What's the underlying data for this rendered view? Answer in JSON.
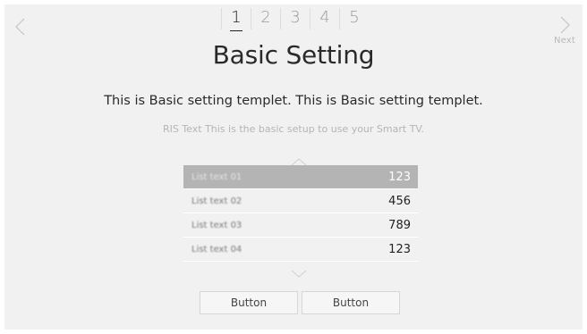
{
  "nav": {
    "prev_icon": "chevron-left-icon",
    "next_icon": "chevron-right-icon",
    "next_label": "Next"
  },
  "steps": [
    {
      "label": "1",
      "active": true
    },
    {
      "label": "2",
      "active": false
    },
    {
      "label": "3",
      "active": false
    },
    {
      "label": "4",
      "active": false
    },
    {
      "label": "5",
      "active": false
    }
  ],
  "title": "Basic Setting",
  "description": "This is Basic setting templet. This is Basic setting templet.",
  "ris_text": "RIS Text This is the basic setup to use your Smart TV.",
  "list": {
    "scroll_up_icon": "chevron-up-icon",
    "scroll_down_icon": "chevron-down-icon",
    "items": [
      {
        "label": "List text 01",
        "value": "123",
        "selected": true
      },
      {
        "label": "List text 02",
        "value": "456",
        "selected": false
      },
      {
        "label": "List text 03",
        "value": "789",
        "selected": false
      },
      {
        "label": "List text 04",
        "value": "123",
        "selected": false
      }
    ]
  },
  "buttons": [
    {
      "label": "Button"
    },
    {
      "label": "Button"
    }
  ],
  "colors": {
    "background": "#f1f1f1",
    "selected_row": "#b4b4b4",
    "muted_text": "#b5b5b5"
  }
}
